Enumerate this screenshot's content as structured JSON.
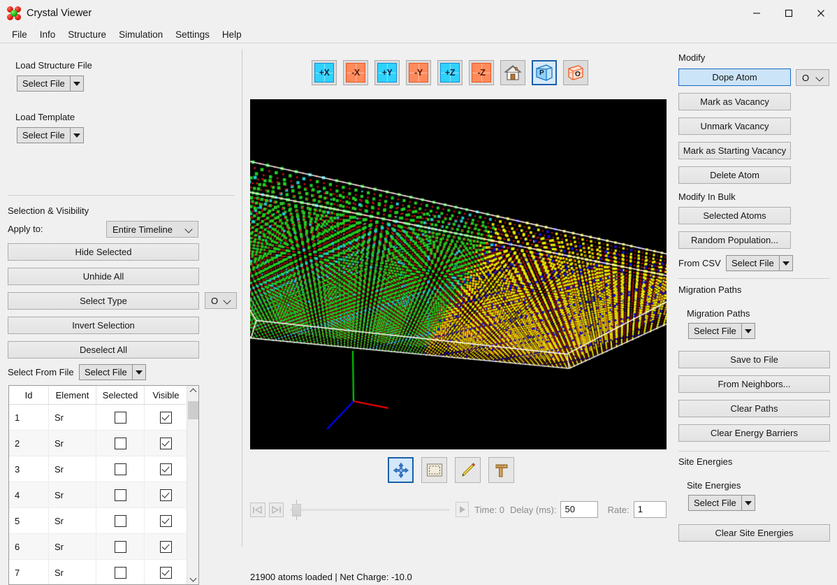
{
  "window": {
    "title": "Crystal Viewer",
    "app_icon": "crystal-lattice-icon",
    "minimize_label": "—",
    "maximize_label": "☐",
    "close_label": "✕"
  },
  "menubar": {
    "items": [
      "File",
      "Info",
      "Structure",
      "Simulation",
      "Settings",
      "Help"
    ]
  },
  "left_panel": {
    "load_structure_label": "Load Structure File",
    "load_structure_combo": "Select File",
    "load_template_label": "Load Template",
    "load_template_combo": "Select File",
    "selection_section_label": "Selection & Visibility",
    "apply_to_label": "Apply to:",
    "apply_to_value": "Entire Timeline",
    "buttons": [
      {
        "label": "Hide Selected"
      },
      {
        "label": "Unhide All"
      },
      {
        "label": "Select Type"
      },
      {
        "label": "Invert Selection"
      },
      {
        "label": "Deselect All"
      }
    ],
    "select_type_element": "O",
    "select_from_file_label": "Select From File",
    "select_from_file_combo": "Select File",
    "table": {
      "columns": [
        "Id",
        "Element",
        "Selected",
        "Visible"
      ],
      "rows": [
        {
          "id": "1",
          "element": "Sr",
          "selected": false,
          "visible": true
        },
        {
          "id": "2",
          "element": "Sr",
          "selected": false,
          "visible": true
        },
        {
          "id": "3",
          "element": "Sr",
          "selected": false,
          "visible": true
        },
        {
          "id": "4",
          "element": "Sr",
          "selected": false,
          "visible": true
        },
        {
          "id": "5",
          "element": "Sr",
          "selected": false,
          "visible": true
        },
        {
          "id": "6",
          "element": "Sr",
          "selected": false,
          "visible": true
        },
        {
          "id": "7",
          "element": "Sr",
          "selected": false,
          "visible": true
        }
      ]
    }
  },
  "viewport": {
    "view_buttons": [
      {
        "label": "+X",
        "name": "view-plus-x-button",
        "color": "cyan"
      },
      {
        "label": "-X",
        "name": "view-minus-x-button",
        "color": "orange"
      },
      {
        "label": "+Y",
        "name": "view-plus-y-button",
        "color": "cyan"
      },
      {
        "label": "-Y",
        "name": "view-minus-y-button",
        "color": "orange"
      },
      {
        "label": "+Z",
        "name": "view-plus-z-button",
        "color": "cyan"
      },
      {
        "label": "-Z",
        "name": "view-minus-z-button",
        "color": "orange"
      }
    ],
    "home_icon": "home-icon",
    "perspective_label": "P",
    "orthographic_label": "O",
    "perspective_selected": true,
    "mode_buttons": [
      {
        "name": "pan-mode-button",
        "icon": "move-arrows-icon",
        "selected": true
      },
      {
        "name": "rectangle-select-mode-button",
        "icon": "rectangle-select-icon",
        "selected": false
      },
      {
        "name": "draw-mode-button",
        "icon": "pencil-icon",
        "selected": false
      },
      {
        "name": "measure-mode-button",
        "icon": "ruler-icon",
        "selected": false
      }
    ],
    "axis_gizmo": {
      "x_color": "#ff0000",
      "y_color": "#00cc00",
      "z_color": "#0000ff"
    },
    "atom_colors": {
      "green": "#22cc22",
      "yellow": "#e8e800",
      "red": "#cc1111",
      "cyan": "#22cccc",
      "blue": "#1515dd",
      "background": "#000000",
      "wireframe": "#ffffff"
    }
  },
  "timeline": {
    "skip_start_icon": "skip-to-start-icon",
    "skip_end_icon": "skip-to-end-icon",
    "play_icon": "play-icon",
    "slider_value": 0,
    "time_label": "Time: 0",
    "delay_label": "Delay (ms):",
    "delay_value": "50",
    "rate_label": "Rate:",
    "rate_value": "1"
  },
  "status": {
    "text": "21900 atoms loaded | Net Charge: -10.0"
  },
  "right_panel": {
    "modify_label": "Modify",
    "dope_atom_label": "Dope Atom",
    "dope_element": "O",
    "mark_vacancy_label": "Mark as Vacancy",
    "unmark_vacancy_label": "Unmark Vacancy",
    "mark_starting_vacancy_label": "Mark as Starting Vacancy",
    "delete_atom_label": "Delete Atom",
    "modify_bulk_label": "Modify In Bulk",
    "selected_atoms_label": "Selected Atoms",
    "random_population_label": "Random Population...",
    "from_csv_label": "From CSV",
    "from_csv_combo": "Select File",
    "migration_paths_section_label": "Migration Paths",
    "migration_paths_label": "Migration Paths",
    "migration_paths_combo": "Select File",
    "save_to_file_label": "Save to File",
    "from_neighbors_label": "From Neighbors...",
    "clear_paths_label": "Clear Paths",
    "clear_energy_barriers_label": "Clear Energy Barriers",
    "site_energies_section_label": "Site Energies",
    "site_energies_label": "Site Energies",
    "site_energies_combo": "Select File",
    "clear_site_energies_label": "Clear Site Energies"
  },
  "colors": {
    "accent": "#1b6ac9",
    "panel_bg": "#f0f0f0",
    "button_bg": "#e3e3e3",
    "viewport_bg": "#000000"
  }
}
